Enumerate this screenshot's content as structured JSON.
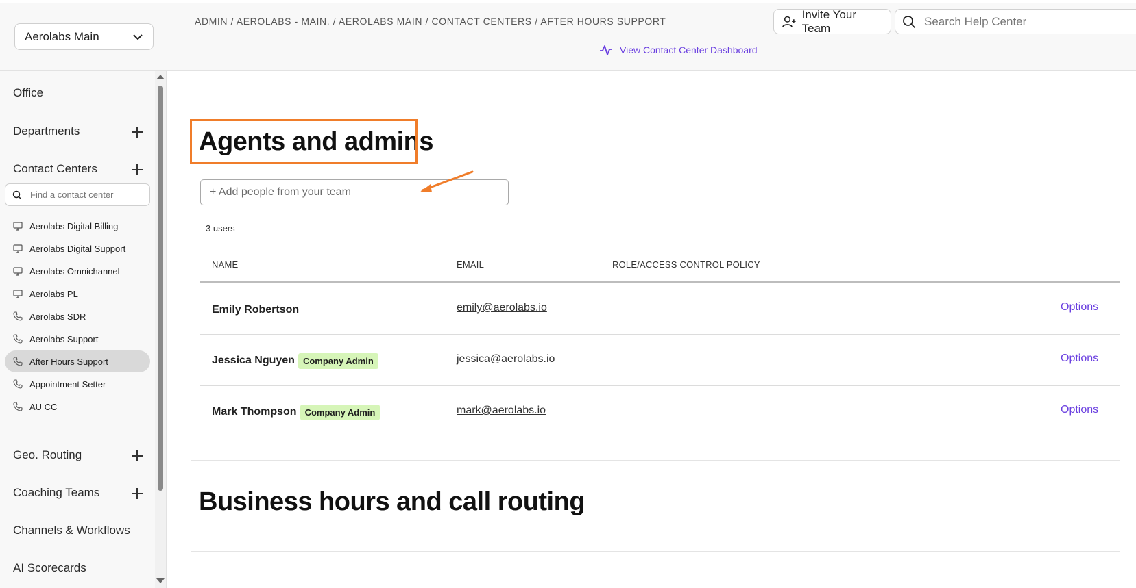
{
  "header": {
    "org_select": "Aerolabs Main",
    "breadcrumb": "ADMIN / AEROLABS - MAIN. / AEROLABS MAIN / CONTACT CENTERS / AFTER HOURS SUPPORT",
    "dashboard_link": "View Contact Center Dashboard",
    "invite_button": "Invite Your Team",
    "search_placeholder": "Search Help Center"
  },
  "sidebar": {
    "office": "Office",
    "departments": "Departments",
    "contact_centers": "Contact Centers",
    "cc_search_placeholder": "Find a contact center",
    "contact_center_items": [
      {
        "label": "Aerolabs Digital Billing",
        "icon": "monitor-icon"
      },
      {
        "label": "Aerolabs Digital Support",
        "icon": "monitor-icon"
      },
      {
        "label": "Aerolabs Omnichannel",
        "icon": "monitor-icon"
      },
      {
        "label": "Aerolabs PL",
        "icon": "monitor-icon"
      },
      {
        "label": "Aerolabs SDR",
        "icon": "phone-icon"
      },
      {
        "label": "Aerolabs Support",
        "icon": "phone-icon"
      },
      {
        "label": "After Hours Support",
        "icon": "phone-icon",
        "active": true
      },
      {
        "label": "Appointment Setter",
        "icon": "phone-icon"
      },
      {
        "label": "AU CC",
        "icon": "phone-icon"
      }
    ],
    "geo_routing": "Geo. Routing",
    "coaching_teams": "Coaching Teams",
    "channels_workflows": "Channels & Workflows",
    "ai_scorecards": "AI Scorecards"
  },
  "main": {
    "agents_title": "Agents and admins",
    "add_people_placeholder": "+ Add people from your team",
    "user_count": "3 users",
    "columns": [
      "NAME",
      "EMAIL",
      "ROLE/ACCESS CONTROL POLICY"
    ],
    "users": [
      {
        "name": "Emily Robertson",
        "badge": "",
        "email": "emily@aerolabs.io",
        "action": "Options"
      },
      {
        "name": "Jessica Nguyen",
        "badge": "Company Admin",
        "email": "jessica@aerolabs.io",
        "action": "Options"
      },
      {
        "name": "Mark Thompson",
        "badge": "Company Admin",
        "email": "mark@aerolabs.io",
        "action": "Options"
      }
    ],
    "business_title": "Business hours and call routing"
  },
  "colors": {
    "accent": "#6a3fe0",
    "highlight": "#f07d2a",
    "badge_bg": "#d6f5b8"
  }
}
